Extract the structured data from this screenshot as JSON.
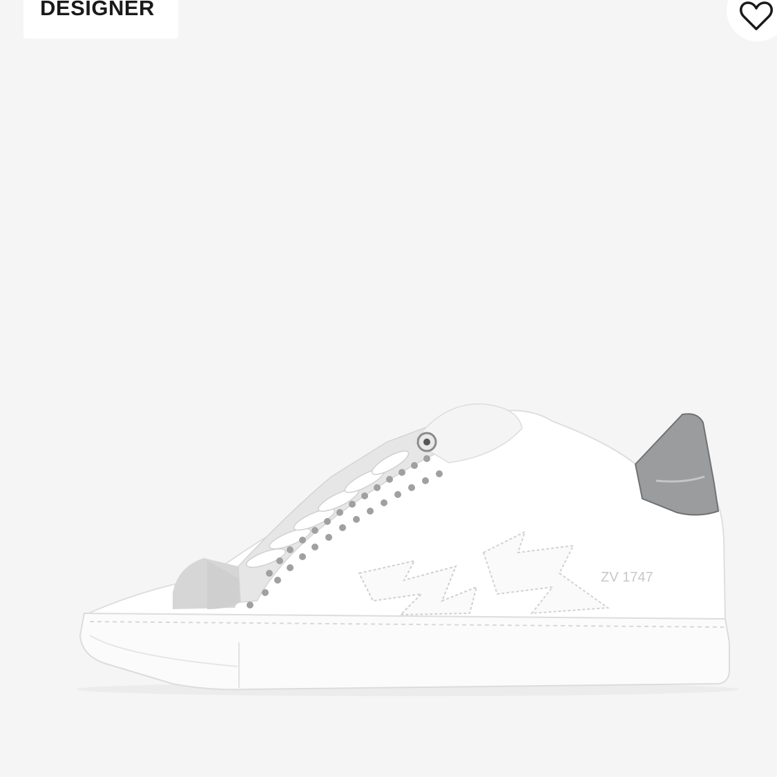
{
  "badge": {
    "label": "DESIGNER"
  },
  "wishlist": {
    "icon": "heart-outline-icon"
  },
  "product_image": {
    "subject": "white low-top leather sneaker with silver heel tab and studs",
    "heel_text": "ZV 1747"
  },
  "colors": {
    "background": "#f5f5f5",
    "badge_bg": "#ffffff",
    "badge_text": "#1a1a1a",
    "heel_tab": "#9a9c9e"
  }
}
